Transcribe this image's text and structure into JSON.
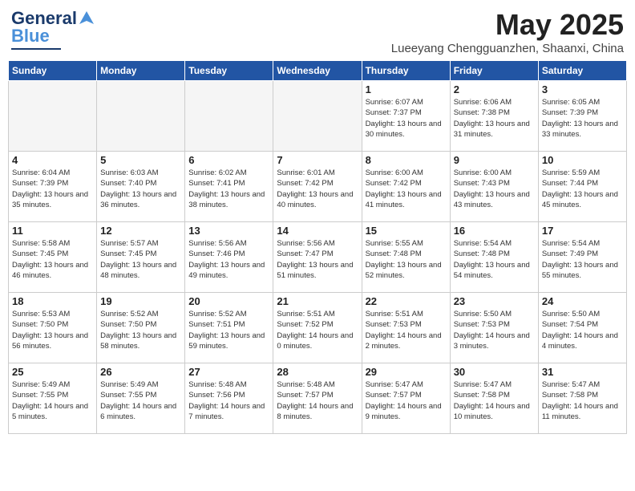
{
  "header": {
    "logo_general": "General",
    "logo_blue": "Blue",
    "month_year": "May 2025",
    "location": "Lueeyang Chengguanzhen, Shaanxi, China"
  },
  "days_of_week": [
    "Sunday",
    "Monday",
    "Tuesday",
    "Wednesday",
    "Thursday",
    "Friday",
    "Saturday"
  ],
  "weeks": [
    [
      {
        "day": "",
        "empty": true
      },
      {
        "day": "",
        "empty": true
      },
      {
        "day": "",
        "empty": true
      },
      {
        "day": "",
        "empty": true
      },
      {
        "day": "1",
        "sunrise": "6:07 AM",
        "sunset": "7:37 PM",
        "daylight": "13 hours and 30 minutes."
      },
      {
        "day": "2",
        "sunrise": "6:06 AM",
        "sunset": "7:38 PM",
        "daylight": "13 hours and 31 minutes."
      },
      {
        "day": "3",
        "sunrise": "6:05 AM",
        "sunset": "7:39 PM",
        "daylight": "13 hours and 33 minutes."
      }
    ],
    [
      {
        "day": "4",
        "sunrise": "6:04 AM",
        "sunset": "7:39 PM",
        "daylight": "13 hours and 35 minutes."
      },
      {
        "day": "5",
        "sunrise": "6:03 AM",
        "sunset": "7:40 PM",
        "daylight": "13 hours and 36 minutes."
      },
      {
        "day": "6",
        "sunrise": "6:02 AM",
        "sunset": "7:41 PM",
        "daylight": "13 hours and 38 minutes."
      },
      {
        "day": "7",
        "sunrise": "6:01 AM",
        "sunset": "7:42 PM",
        "daylight": "13 hours and 40 minutes."
      },
      {
        "day": "8",
        "sunrise": "6:00 AM",
        "sunset": "7:42 PM",
        "daylight": "13 hours and 41 minutes."
      },
      {
        "day": "9",
        "sunrise": "6:00 AM",
        "sunset": "7:43 PM",
        "daylight": "13 hours and 43 minutes."
      },
      {
        "day": "10",
        "sunrise": "5:59 AM",
        "sunset": "7:44 PM",
        "daylight": "13 hours and 45 minutes."
      }
    ],
    [
      {
        "day": "11",
        "sunrise": "5:58 AM",
        "sunset": "7:45 PM",
        "daylight": "13 hours and 46 minutes."
      },
      {
        "day": "12",
        "sunrise": "5:57 AM",
        "sunset": "7:45 PM",
        "daylight": "13 hours and 48 minutes."
      },
      {
        "day": "13",
        "sunrise": "5:56 AM",
        "sunset": "7:46 PM",
        "daylight": "13 hours and 49 minutes."
      },
      {
        "day": "14",
        "sunrise": "5:56 AM",
        "sunset": "7:47 PM",
        "daylight": "13 hours and 51 minutes."
      },
      {
        "day": "15",
        "sunrise": "5:55 AM",
        "sunset": "7:48 PM",
        "daylight": "13 hours and 52 minutes."
      },
      {
        "day": "16",
        "sunrise": "5:54 AM",
        "sunset": "7:48 PM",
        "daylight": "13 hours and 54 minutes."
      },
      {
        "day": "17",
        "sunrise": "5:54 AM",
        "sunset": "7:49 PM",
        "daylight": "13 hours and 55 minutes."
      }
    ],
    [
      {
        "day": "18",
        "sunrise": "5:53 AM",
        "sunset": "7:50 PM",
        "daylight": "13 hours and 56 minutes."
      },
      {
        "day": "19",
        "sunrise": "5:52 AM",
        "sunset": "7:50 PM",
        "daylight": "13 hours and 58 minutes."
      },
      {
        "day": "20",
        "sunrise": "5:52 AM",
        "sunset": "7:51 PM",
        "daylight": "13 hours and 59 minutes."
      },
      {
        "day": "21",
        "sunrise": "5:51 AM",
        "sunset": "7:52 PM",
        "daylight": "14 hours and 0 minutes."
      },
      {
        "day": "22",
        "sunrise": "5:51 AM",
        "sunset": "7:53 PM",
        "daylight": "14 hours and 2 minutes."
      },
      {
        "day": "23",
        "sunrise": "5:50 AM",
        "sunset": "7:53 PM",
        "daylight": "14 hours and 3 minutes."
      },
      {
        "day": "24",
        "sunrise": "5:50 AM",
        "sunset": "7:54 PM",
        "daylight": "14 hours and 4 minutes."
      }
    ],
    [
      {
        "day": "25",
        "sunrise": "5:49 AM",
        "sunset": "7:55 PM",
        "daylight": "14 hours and 5 minutes."
      },
      {
        "day": "26",
        "sunrise": "5:49 AM",
        "sunset": "7:55 PM",
        "daylight": "14 hours and 6 minutes."
      },
      {
        "day": "27",
        "sunrise": "5:48 AM",
        "sunset": "7:56 PM",
        "daylight": "14 hours and 7 minutes."
      },
      {
        "day": "28",
        "sunrise": "5:48 AM",
        "sunset": "7:57 PM",
        "daylight": "14 hours and 8 minutes."
      },
      {
        "day": "29",
        "sunrise": "5:47 AM",
        "sunset": "7:57 PM",
        "daylight": "14 hours and 9 minutes."
      },
      {
        "day": "30",
        "sunrise": "5:47 AM",
        "sunset": "7:58 PM",
        "daylight": "14 hours and 10 minutes."
      },
      {
        "day": "31",
        "sunrise": "5:47 AM",
        "sunset": "7:58 PM",
        "daylight": "14 hours and 11 minutes."
      }
    ]
  ]
}
